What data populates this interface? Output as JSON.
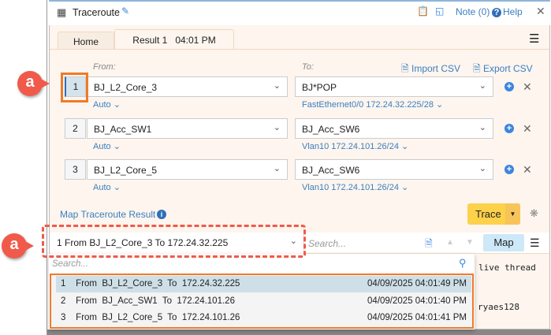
{
  "window": {
    "title": "Traceroute",
    "note": "Note (0)",
    "help": "Help"
  },
  "tabs": [
    {
      "label": "Home"
    },
    {
      "label": "Result 1   04:01 PM"
    }
  ],
  "form": {
    "from_label": "From:",
    "to_label": "To:",
    "import_csv": "Import CSV",
    "export_csv": "Export CSV",
    "rows": [
      {
        "num": "1",
        "from": "BJ_L2_Core_3",
        "from_option": "Auto",
        "to": "BJ*POP",
        "to_option": "FastEthernet0/0 172.24.32.225/28"
      },
      {
        "num": "2",
        "from": "BJ_Acc_SW1",
        "from_option": "Auto",
        "to": "BJ_Acc_SW6",
        "to_option": "Vlan10 172.24.101.26/24"
      },
      {
        "num": "3",
        "from": "BJ_L2_Core_5",
        "from_option": "Auto",
        "to": "BJ_Acc_SW6",
        "to_option": "Vlan10 172.24.101.26/24"
      }
    ]
  },
  "map_result_label": "Map Traceroute Result",
  "trace_button": "Trace",
  "toolbar": {
    "result_selected": "1 From BJ_L2_Core_3 To 172.24.32.225",
    "search_placeholder": "Search...",
    "map_button": "Map"
  },
  "dropdown": {
    "search_placeholder": "Search...",
    "items": [
      {
        "text": "1    From  BJ_L2_Core_3  To  172.24.32.225",
        "time": "04/09/2025 04:01:49 PM"
      },
      {
        "text": "2    From  BJ_Acc_SW1  To  172.24.101.26",
        "time": "04/09/2025 04:01:40 PM"
      },
      {
        "text": "3    From  BJ_L2_Core_5  To  172.24.101.26",
        "time": "04/09/2025 04:01:41 PM"
      }
    ]
  },
  "console": {
    "line1": "live thread",
    "line2": "ryaes128"
  },
  "annotations": {
    "badge1": "a",
    "badge2": "a"
  }
}
